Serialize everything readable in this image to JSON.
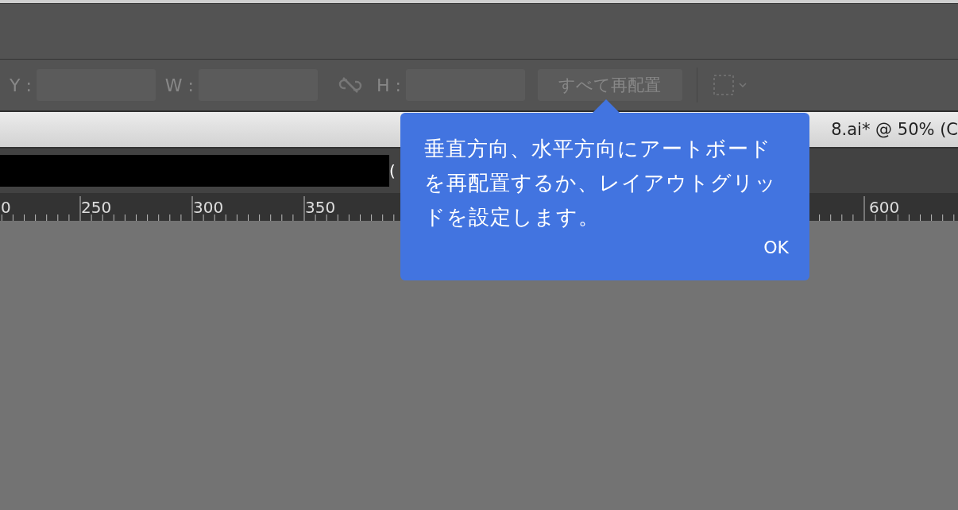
{
  "toolbar": {
    "fields": [
      {
        "label": "Y :"
      },
      {
        "label": "W :"
      },
      {
        "label": "H :"
      }
    ],
    "rearrange_button": "すべて再配置"
  },
  "document_tab": {
    "title": "8.ai* @ 50% (C"
  },
  "title_strip": {
    "text": "("
  },
  "ruler": {
    "labels": [
      "0",
      "250",
      "300",
      "350",
      "600"
    ]
  },
  "tooltip": {
    "text": "垂直方向、水平方向にアートボードを再配置するか、レイアウトグリッドを設定します。",
    "button": "OK"
  }
}
